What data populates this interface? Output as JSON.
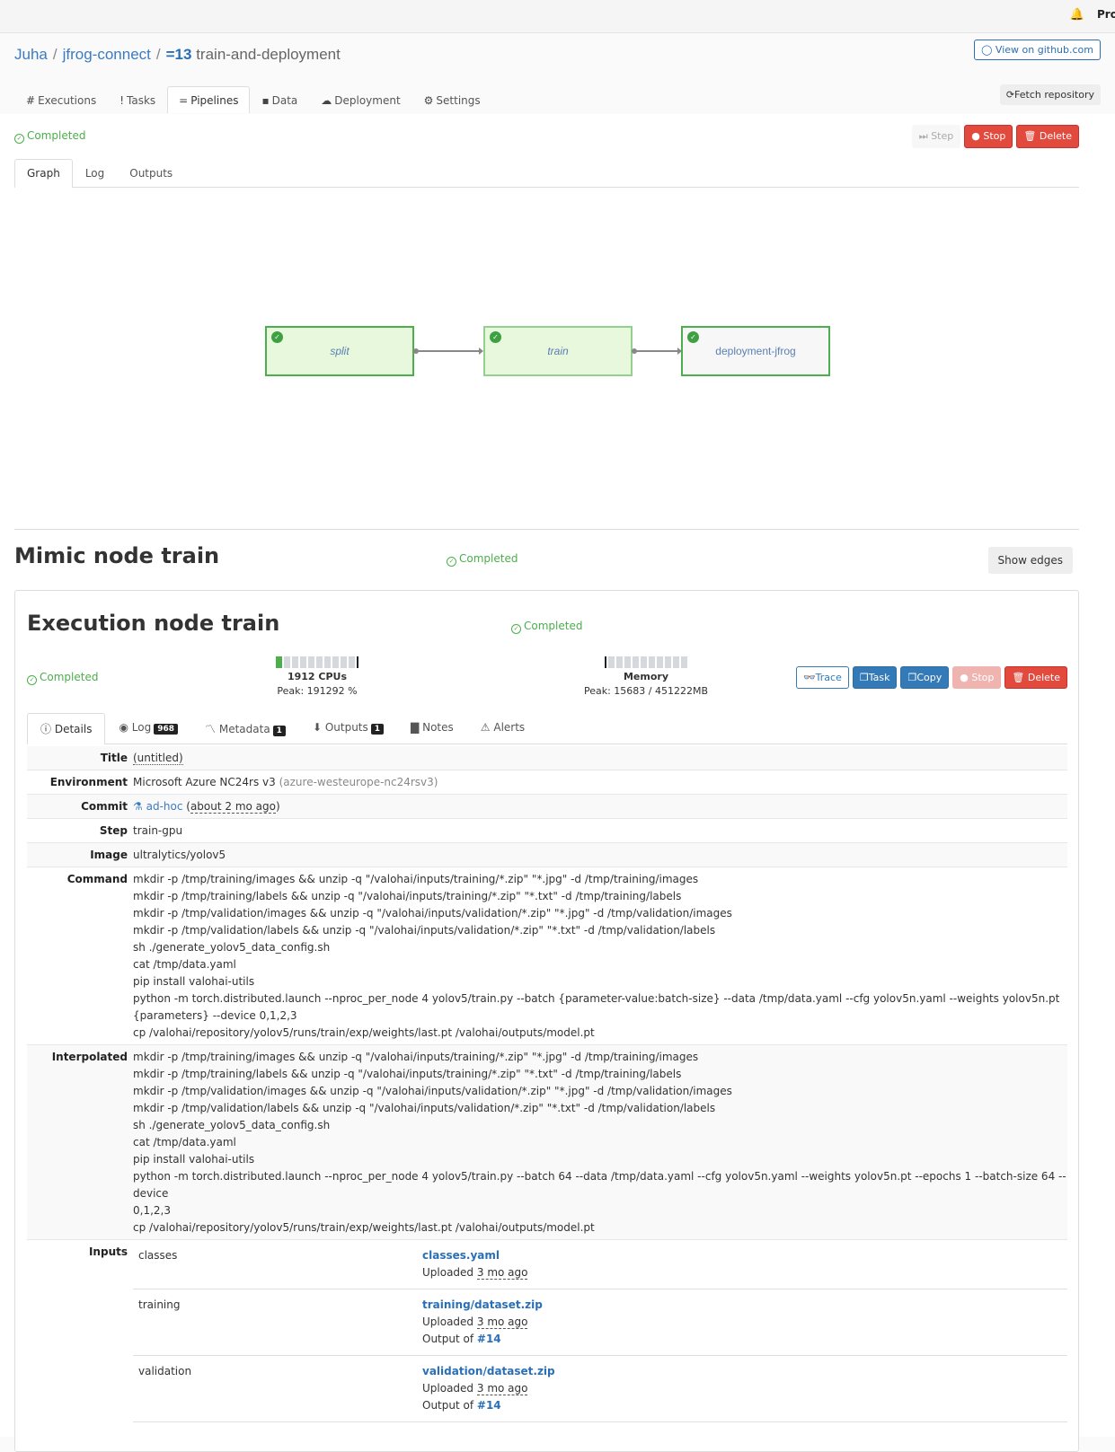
{
  "topbar": {
    "user_label": "Pro"
  },
  "breadcrumb": {
    "owner": "Juha",
    "project": "jfrog-connect",
    "pipeline_number": "=13",
    "pipeline_name": "train-and-deployment"
  },
  "header": {
    "github_label": "View on github.com",
    "fetch_label": "Fetch repository"
  },
  "nav_tabs": [
    {
      "icon": "#",
      "label": "Executions"
    },
    {
      "icon": "!",
      "label": "Tasks"
    },
    {
      "icon": "=",
      "label": "Pipelines",
      "active": true
    },
    {
      "icon": "▪",
      "label": "Data"
    },
    {
      "icon": "☁",
      "label": "Deployment"
    },
    {
      "icon": "⚙",
      "label": "Settings"
    }
  ],
  "pipeline": {
    "status": "Completed",
    "actions": {
      "step": "Step",
      "stop": "Stop",
      "delete": "Delete"
    },
    "tabs": [
      "Graph",
      "Log",
      "Outputs"
    ],
    "active_tab": "Graph",
    "nodes": [
      {
        "name": "split",
        "status": "completed"
      },
      {
        "name": "train",
        "status": "completed"
      },
      {
        "name": "deployment-jfrog",
        "status": "completed"
      }
    ]
  },
  "mimic": {
    "title": "Mimic node train",
    "status": "Completed",
    "show_edges": "Show edges"
  },
  "execution": {
    "title": "Execution node train",
    "status": "Completed",
    "cpu": {
      "label": "1912 CPUs",
      "peak": "Peak: 191292 %",
      "fill_fraction": 0.1
    },
    "memory": {
      "label": "Memory",
      "peak": "Peak: 15683 / 451222MB",
      "fill_fraction": 0.03
    },
    "actions": {
      "trace": "Trace",
      "task": "Task",
      "copy": "Copy",
      "stop": "Stop",
      "delete": "Delete"
    },
    "tabs": [
      {
        "label": "Details",
        "icon": "info-icon",
        "active": true
      },
      {
        "label": "Log",
        "icon": "eye-icon",
        "badge": "968"
      },
      {
        "label": "Metadata",
        "icon": "chart-icon",
        "badge": "1"
      },
      {
        "label": "Outputs",
        "icon": "download-icon",
        "badge": "1"
      },
      {
        "label": "Notes",
        "icon": "note-icon"
      },
      {
        "label": "Alerts",
        "icon": "warning-icon"
      }
    ],
    "details": {
      "title_label": "Title",
      "title_value": "(untitled)",
      "environment_label": "Environment",
      "environment_value": "Microsoft Azure NC24rs v3",
      "environment_slug": "(azure-westeurope-nc24rsv3)",
      "commit_label": "Commit",
      "commit_value": "ad-hoc",
      "commit_time": "about 2 mo ago",
      "step_label": "Step",
      "step_value": "train-gpu",
      "image_label": "Image",
      "image_value": "ultralytics/yolov5",
      "command_label": "Command",
      "command_lines": [
        "mkdir -p /tmp/training/images && unzip -q \"/valohai/inputs/training/*.zip\" \"*.jpg\" -d /tmp/training/images",
        "mkdir -p /tmp/training/labels && unzip -q \"/valohai/inputs/training/*.zip\" \"*.txt\" -d /tmp/training/labels",
        "mkdir -p /tmp/validation/images && unzip -q \"/valohai/inputs/validation/*.zip\" \"*.jpg\" -d /tmp/validation/images",
        "mkdir -p /tmp/validation/labels && unzip -q \"/valohai/inputs/validation/*.zip\" \"*.txt\" -d /tmp/validation/labels",
        "sh ./generate_yolov5_data_config.sh",
        "cat /tmp/data.yaml",
        "pip install valohai-utils",
        "python -m torch.distributed.launch --nproc_per_node 4 yolov5/train.py --batch {parameter-value:batch-size} --data /tmp/data.yaml --cfg yolov5n.yaml --weights yolov5n.pt",
        "{parameters} --device 0,1,2,3",
        "cp /valohai/repository/yolov5/runs/train/exp/weights/last.pt /valohai/outputs/model.pt"
      ],
      "interpolated_label": "Interpolated",
      "interpolated_lines": [
        "mkdir -p /tmp/training/images && unzip -q \"/valohai/inputs/training/*.zip\" \"*.jpg\" -d /tmp/training/images",
        "mkdir -p /tmp/training/labels && unzip -q \"/valohai/inputs/training/*.zip\" \"*.txt\" -d /tmp/training/labels",
        "mkdir -p /tmp/validation/images && unzip -q \"/valohai/inputs/validation/*.zip\" \"*.jpg\" -d /tmp/validation/images",
        "mkdir -p /tmp/validation/labels && unzip -q \"/valohai/inputs/validation/*.zip\" \"*.txt\" -d /tmp/validation/labels",
        "sh ./generate_yolov5_data_config.sh",
        "cat /tmp/data.yaml",
        "pip install valohai-utils",
        "python -m torch.distributed.launch --nproc_per_node 4 yolov5/train.py --batch 64 --data /tmp/data.yaml --cfg yolov5n.yaml --weights yolov5n.pt --epochs 1 --batch-size 64 --device",
        "0,1,2,3",
        "cp /valohai/repository/yolov5/runs/train/exp/weights/last.pt /valohai/outputs/model.pt"
      ],
      "inputs_label": "Inputs",
      "inputs": [
        {
          "name": "classes",
          "file": "classes.yaml",
          "uploaded_prefix": "Uploaded",
          "uploaded": "3 mo ago"
        },
        {
          "name": "training",
          "file": "training/dataset.zip",
          "uploaded_prefix": "Uploaded",
          "uploaded": "3 mo ago",
          "output_prefix": "Output of",
          "output_of": "#14"
        },
        {
          "name": "validation",
          "file": "validation/dataset.zip",
          "uploaded_prefix": "Uploaded",
          "uploaded": "3 mo ago",
          "output_prefix": "Output of",
          "output_of": "#14"
        }
      ]
    }
  }
}
